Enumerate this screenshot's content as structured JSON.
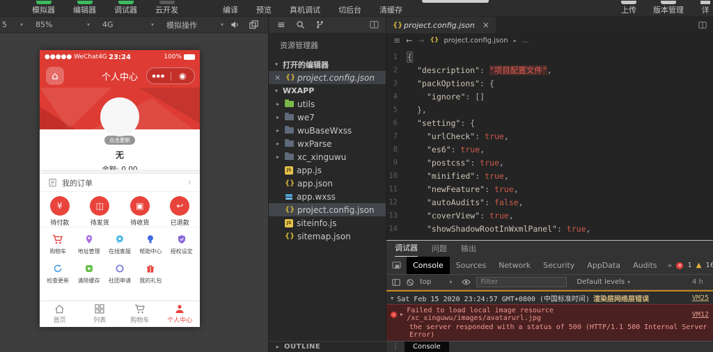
{
  "toolbar": {
    "tabs": [
      {
        "label": "模拟器"
      },
      {
        "label": "编辑器"
      },
      {
        "label": "调试器"
      },
      {
        "label": "云开发"
      }
    ],
    "actions": [
      {
        "label": "编译"
      },
      {
        "label": "预览"
      },
      {
        "label": "真机调试"
      },
      {
        "label": "切后台"
      },
      {
        "label": "清缓存"
      }
    ],
    "right": [
      {
        "label": "上传"
      },
      {
        "label": "版本管理"
      },
      {
        "label": "详"
      }
    ]
  },
  "simbar": {
    "device": "5",
    "zoom": "85%",
    "network": "4G",
    "action": "模拟操作"
  },
  "phone": {
    "status": {
      "carrier": "●●●●● WeChat4G",
      "time": "23:24",
      "battery": "100%"
    },
    "nav": {
      "title": "个人中心",
      "home_glyph": "⌂",
      "menu_dots": "●●●",
      "capsule_circle": "◉"
    },
    "profile": {
      "update_badge": "点击更新",
      "nickname": "无",
      "balance": "余额: 0.00"
    },
    "orders": {
      "title": "我的订单",
      "chevron": "›"
    },
    "order_items": [
      {
        "label": "待付款",
        "icon": "wallet-icon",
        "glyph": "¥"
      },
      {
        "label": "待发货",
        "icon": "box-icon",
        "glyph": "◫"
      },
      {
        "label": "待收货",
        "icon": "package-icon",
        "glyph": "▣"
      },
      {
        "label": "已退款",
        "icon": "refund-icon",
        "glyph": "↩"
      }
    ],
    "grid1": [
      {
        "label": "购物车"
      },
      {
        "label": "地址管理"
      },
      {
        "label": "在线客服"
      },
      {
        "label": "帮助中心"
      },
      {
        "label": "授权设定"
      }
    ],
    "grid2": [
      {
        "label": "检查更新"
      },
      {
        "label": "清除缓存"
      },
      {
        "label": "社团申请"
      },
      {
        "label": "我的礼包"
      }
    ],
    "tabbar": [
      {
        "label": "首页"
      },
      {
        "label": "列表"
      },
      {
        "label": "购物车"
      },
      {
        "label": "个人中心"
      }
    ]
  },
  "explorer": {
    "title": "资源管理器",
    "open_editors_label": "打开的编辑器",
    "open_file": "project.config.json",
    "project_label": "WXAPP",
    "outline_label": "OUTLINE",
    "tree": [
      {
        "name": "utils"
      },
      {
        "name": "we7"
      },
      {
        "name": "wuBaseWxss"
      },
      {
        "name": "wxParse"
      },
      {
        "name": "xc_xinguwu"
      },
      {
        "name": "app.js"
      },
      {
        "name": "app.json"
      },
      {
        "name": "app.wxss"
      },
      {
        "name": "project.config.json"
      },
      {
        "name": "siteinfo.js"
      },
      {
        "name": "sitemap.json"
      }
    ]
  },
  "editor": {
    "tab_file": "project.config.json",
    "breadcrumb_file": "project.config.json",
    "breadcrumb_more": "…",
    "code": [
      {
        "n": "1",
        "txt": "{"
      },
      {
        "n": "2",
        "key": "\"description\"",
        "sep": ": ",
        "val": "\"项目配置文件\"",
        "end": ","
      },
      {
        "n": "3",
        "key": "\"packOptions\"",
        "sep": ": ",
        "val": "{",
        "end": ""
      },
      {
        "n": "4",
        "key": "\"ignore\"",
        "sep": ": ",
        "val": "[]",
        "end": ""
      },
      {
        "n": "5",
        "txt": "},"
      },
      {
        "n": "6",
        "key": "\"setting\"",
        "sep": ": ",
        "val": "{",
        "end": ""
      },
      {
        "n": "7",
        "key": "\"urlCheck\"",
        "sep": ": ",
        "val": "true",
        "end": ","
      },
      {
        "n": "8",
        "key": "\"es6\"",
        "sep": ": ",
        "val": "true",
        "end": ","
      },
      {
        "n": "9",
        "key": "\"postcss\"",
        "sep": ": ",
        "val": "true",
        "end": ","
      },
      {
        "n": "10",
        "key": "\"minified\"",
        "sep": ": ",
        "val": "true",
        "end": ","
      },
      {
        "n": "11",
        "key": "\"newFeature\"",
        "sep": ": ",
        "val": "true",
        "end": ","
      },
      {
        "n": "12",
        "key": "\"autoAudits\"",
        "sep": ": ",
        "val": "false",
        "end": ","
      },
      {
        "n": "13",
        "key": "\"coverView\"",
        "sep": ": ",
        "val": "true",
        "end": ","
      },
      {
        "n": "14",
        "key": "\"showShadowRootInWxmlPanel\"",
        "sep": ": ",
        "val": "true",
        "end": ","
      }
    ]
  },
  "devtools": {
    "tabs": [
      {
        "label": "调试器"
      },
      {
        "label": "问题"
      },
      {
        "label": "输出"
      }
    ],
    "panels": [
      {
        "label": "Console"
      },
      {
        "label": "Sources"
      },
      {
        "label": "Network"
      },
      {
        "label": "Security"
      },
      {
        "label": "AppData"
      },
      {
        "label": "Audits"
      }
    ],
    "overflow": "»",
    "error_count": "1",
    "warning_count": "16",
    "context": "top",
    "filter_placeholder": "Filter",
    "levels": "Default levels",
    "hidden_note": "4 h",
    "console": {
      "group_prefix": "Sat Feb 15 2020 23:24:57 GMT+0800 (中国标准时间)",
      "group_label": "渲染层网络层错误",
      "group_link": "VM25",
      "error_line1": "Failed to load local image resource /xc_xinguwu/images/avatarurl.jpg",
      "error_line2": "the server responded with a status of 500 (HTTP/1.1 500 Internal Server Error)",
      "error_link": "VM12",
      "prompt": "›",
      "drawer_tab": "Console"
    }
  },
  "colors": {
    "accent_red": "#dd3b33",
    "icon_red": "#e8443c",
    "toolbar_green": "#3cbb5f",
    "console_error_bg": "#4b2020"
  }
}
